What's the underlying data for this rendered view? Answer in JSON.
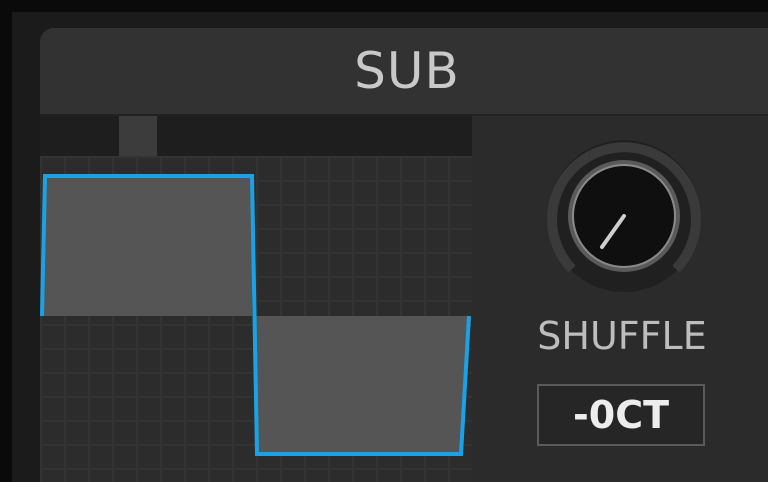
{
  "panel": {
    "title": "SUB"
  },
  "waveform": {
    "shape": "square",
    "line_color": "#19a3e6",
    "fill_color": "#555555"
  },
  "knob": {
    "label": "SHUFFLE",
    "icon": "knob-icon"
  },
  "octave": {
    "value": "-0CT"
  },
  "colors": {
    "accent": "#19a3e6",
    "text": "#c9c9c9",
    "panel_bg": "#2a2a2a"
  }
}
